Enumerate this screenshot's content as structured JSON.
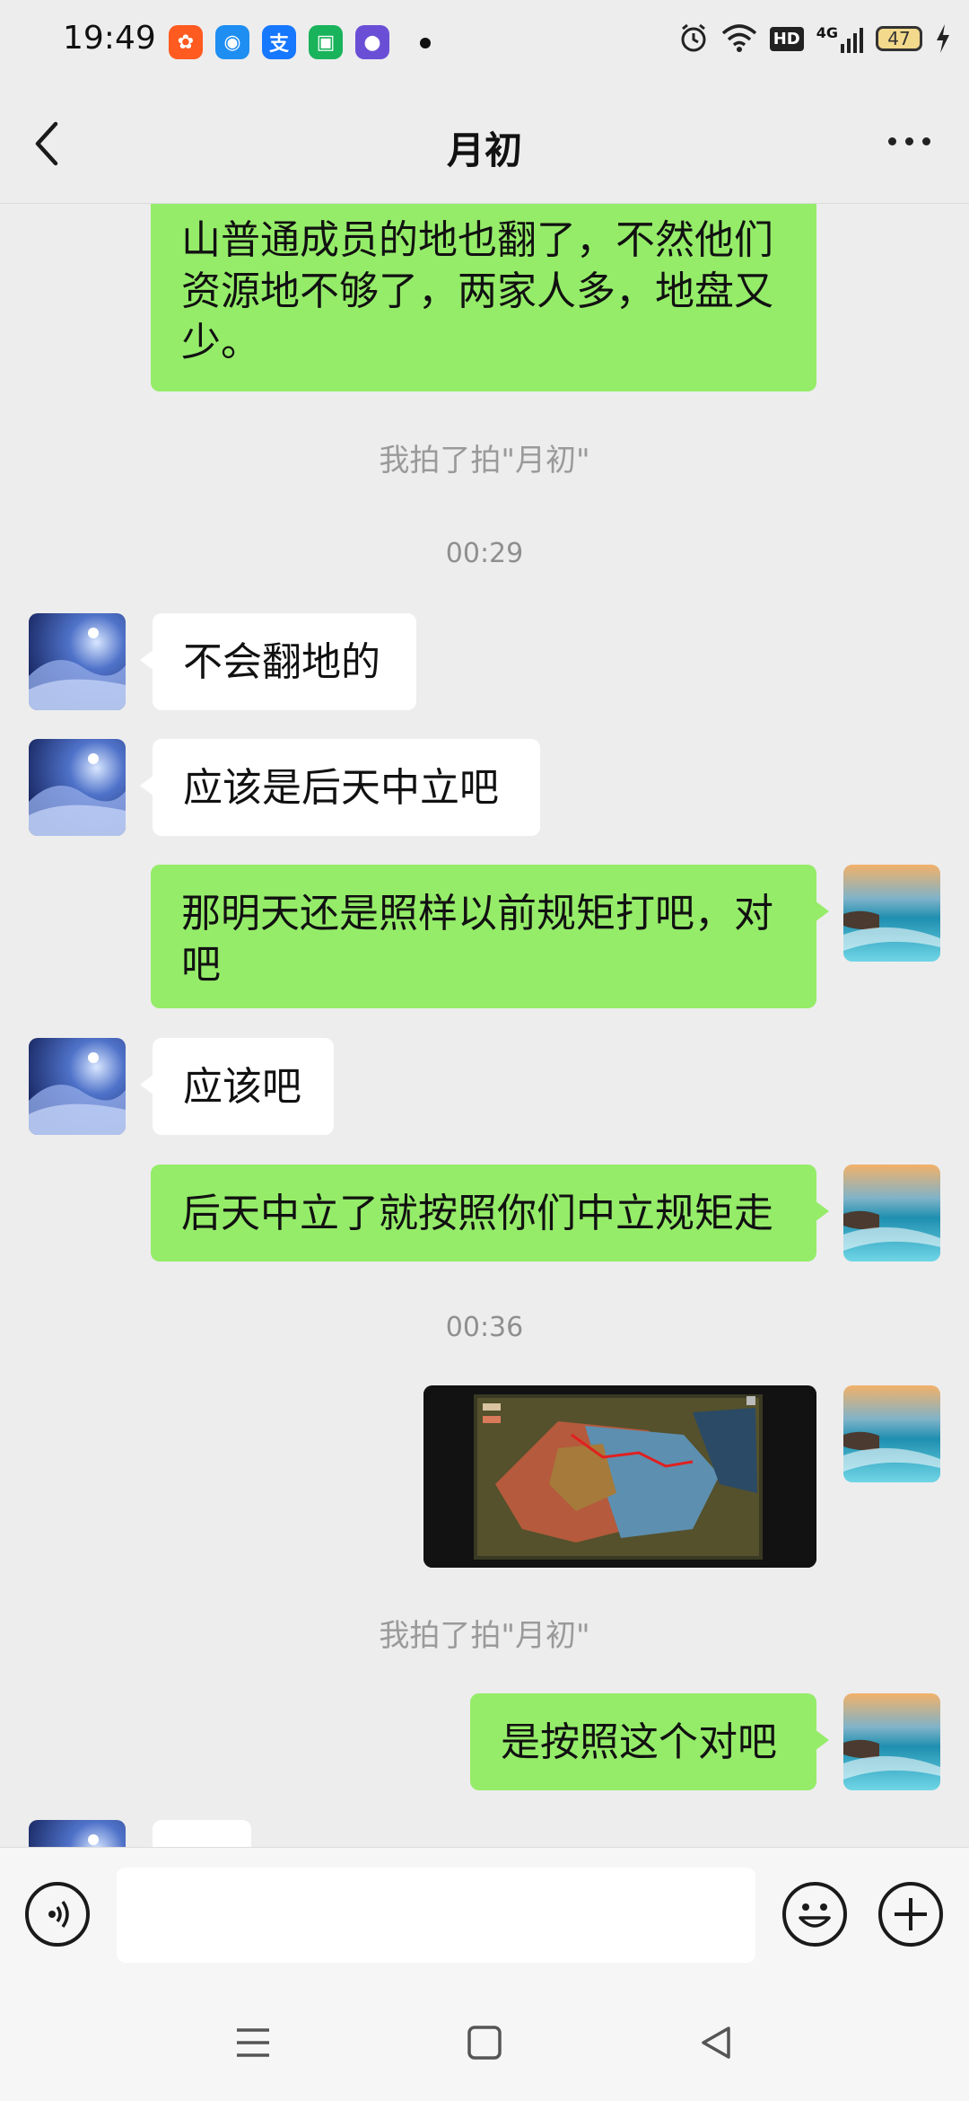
{
  "status_bar": {
    "time": "19:49",
    "battery": "47",
    "icons": [
      "kuaishou-app-icon",
      "browser-app-icon",
      "alipay-app-icon",
      "shop-app-icon",
      "music-app-icon",
      "alarm-icon",
      "wifi-icon",
      "hd-icon",
      "signal-4g-icon",
      "battery-icon",
      "charging-icon"
    ],
    "hd_label": "HD",
    "network_label": "4G"
  },
  "header": {
    "title": "月初"
  },
  "messages": {
    "m1_line1": "山普通成员的地也翻了，不然他们",
    "m1_line2": "资源地不够了，两家人多，地盘又",
    "m1_line3": "少。",
    "sys1": "我拍了拍\"月初\"",
    "time1": "00:29",
    "m2": "不会翻地的",
    "m3": "应该是后天中立吧",
    "m4_line1": "那明天还是照样以前规矩打吧，对",
    "m4_line2": "吧",
    "m5": "应该吧",
    "m6": "后天中立了就按照你们中立规矩走",
    "time2": "00:36",
    "sys2": "我拍了拍\"月初\"",
    "m7": "是按照这个对吧"
  },
  "input": {
    "value": "",
    "placeholder": ""
  },
  "colors": {
    "background": "#ededed",
    "outgoing_bubble": "#95ec69",
    "incoming_bubble": "#ffffff",
    "system_text": "#9a9a9a"
  }
}
